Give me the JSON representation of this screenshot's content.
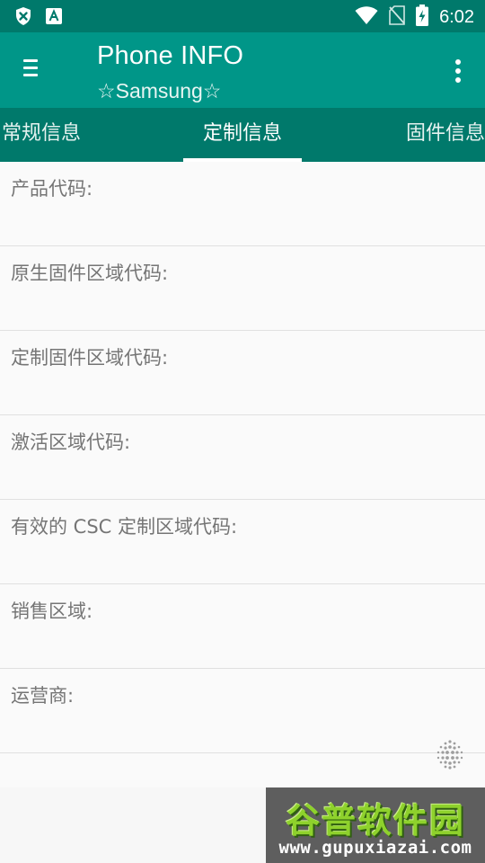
{
  "status_bar": {
    "time": "6:02",
    "icons": [
      "shield-x-icon",
      "font-a-icon",
      "wifi-icon",
      "no-sim-icon",
      "battery-charging-icon"
    ]
  },
  "app_bar": {
    "title": "Phone INFO",
    "subtitle": "☆Samsung☆"
  },
  "tabs": {
    "items": [
      {
        "label": "常规信息",
        "active": false
      },
      {
        "label": "定制信息",
        "active": true
      },
      {
        "label": "固件信息",
        "active": false
      }
    ]
  },
  "fields": [
    {
      "label": "产品代码:"
    },
    {
      "label": "原生固件区域代码:"
    },
    {
      "label": "定制固件区域代码:"
    },
    {
      "label": "激活区域代码:"
    },
    {
      "label": "有效的 CSC 定制区域代码:"
    },
    {
      "label": "销售区域:"
    },
    {
      "label": "运营商:"
    }
  ],
  "watermark": {
    "brand": "谷普软件园",
    "url": "www.gupuxiazai.com"
  },
  "colors": {
    "status_bar": "#00796b",
    "app_bar": "#009688",
    "tab_bar": "#00796b",
    "label_text": "#757575",
    "watermark_green": "#8ed12c"
  }
}
